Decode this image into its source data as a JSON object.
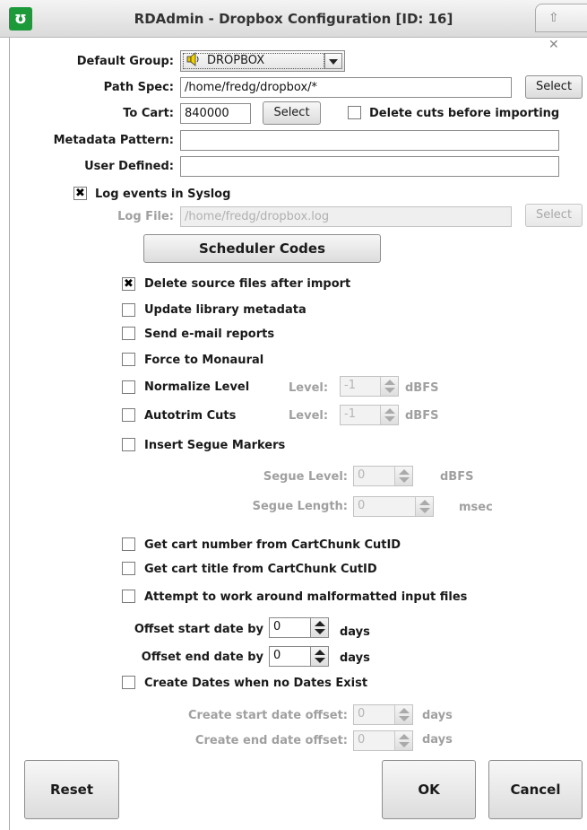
{
  "window": {
    "title": "RDAdmin - Dropbox Configuration [ID: 16]",
    "controls": "⇧ ✕"
  },
  "default_group": {
    "label": "Default Group:",
    "value": "DROPBOX"
  },
  "path_spec": {
    "label": "Path Spec:",
    "value": "/home/fredg/dropbox/*",
    "button": "Select"
  },
  "to_cart": {
    "label": "To Cart:",
    "value": "840000",
    "button": "Select",
    "delete_cuts_label": "Delete cuts before importing",
    "delete_cuts_checked": false
  },
  "metadata_pattern": {
    "label": "Metadata Pattern:",
    "value": ""
  },
  "user_defined": {
    "label": "User Defined:",
    "value": ""
  },
  "log_syslog": {
    "label": "Log events in Syslog",
    "checked": true
  },
  "log_file": {
    "label": "Log File:",
    "value": "/home/fredg/dropbox.log",
    "button": "Select"
  },
  "scheduler_codes": {
    "label": "Scheduler Codes"
  },
  "options": {
    "delete_source": {
      "label": "Delete source files after import",
      "checked": true
    },
    "update_metadata": {
      "label": "Update library metadata",
      "checked": false
    },
    "send_email": {
      "label": "Send e-mail reports",
      "checked": false
    },
    "force_mono": {
      "label": "Force to Monaural",
      "checked": false
    },
    "normalize": {
      "label": "Normalize Level",
      "checked": false,
      "level_label": "Level:",
      "level_value": "-1",
      "unit": "dBFS"
    },
    "autotrim": {
      "label": "Autotrim Cuts",
      "checked": false,
      "level_label": "Level:",
      "level_value": "-1",
      "unit": "dBFS"
    },
    "segue": {
      "label": "Insert Segue Markers",
      "checked": false,
      "level_label": "Segue Level:",
      "level_value": "0",
      "level_unit": "dBFS",
      "length_label": "Segue Length:",
      "length_value": "0",
      "length_unit": "msec"
    },
    "cartchunk_number": {
      "label": "Get cart number from CartChunk CutID",
      "checked": false
    },
    "cartchunk_title": {
      "label": "Get cart title from CartChunk CutID",
      "checked": false
    },
    "malformatted": {
      "label": "Attempt to work around malformatted input files",
      "checked": false
    }
  },
  "offset_start": {
    "label": "Offset start date by",
    "value": "0",
    "unit": "days"
  },
  "offset_end": {
    "label": "Offset end date by",
    "value": "0",
    "unit": "days"
  },
  "create_dates": {
    "label": "Create Dates when no Dates Exist",
    "checked": false,
    "start_label": "Create start date offset:",
    "start_value": "0",
    "start_unit": "days",
    "end_label": "Create end date offset:",
    "end_value": "0",
    "end_unit": "days"
  },
  "buttons": {
    "reset": "Reset",
    "ok": "OK",
    "cancel": "Cancel"
  }
}
